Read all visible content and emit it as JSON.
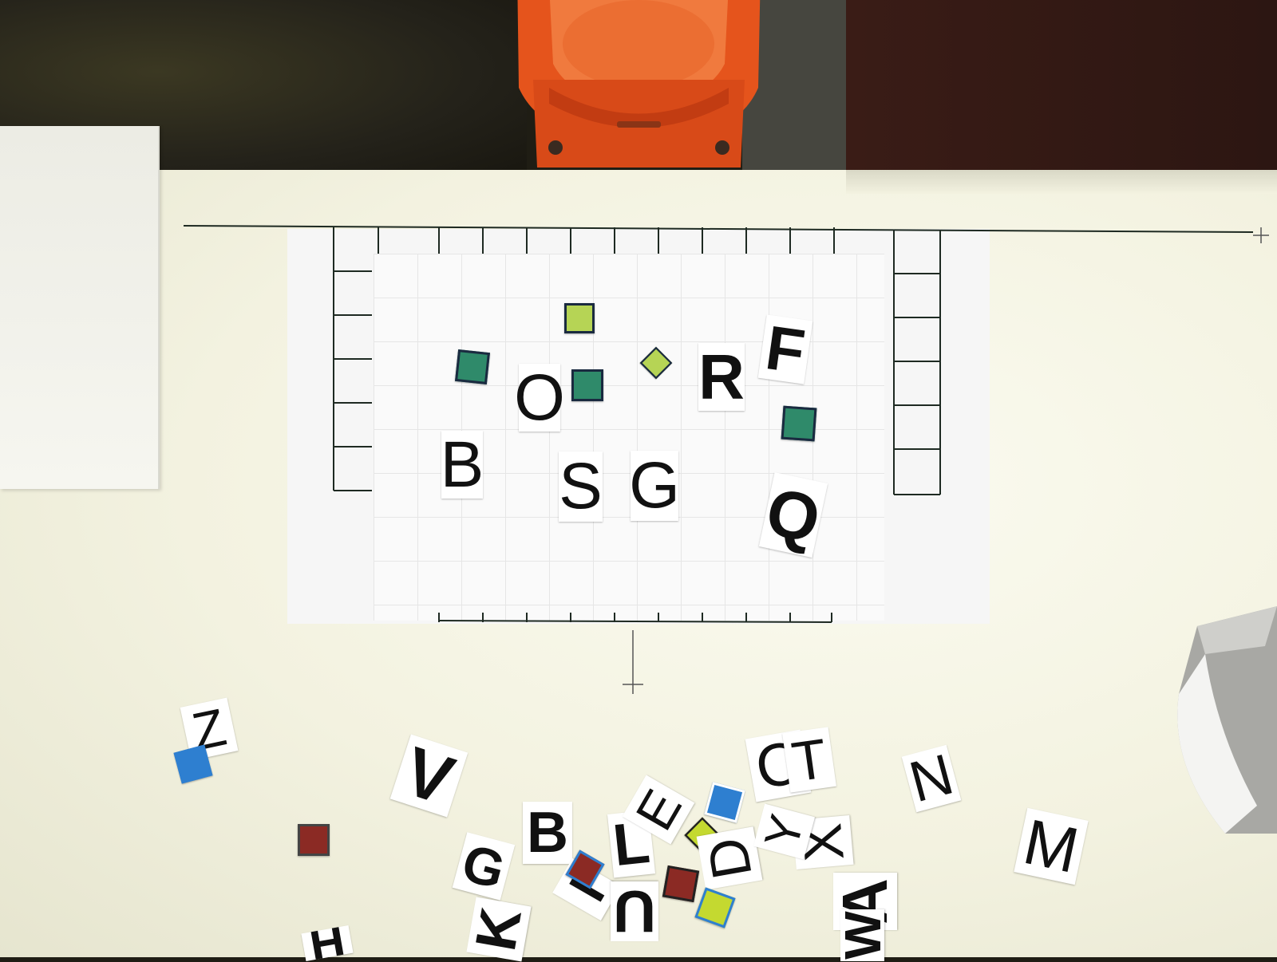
{
  "scene": {
    "board_letters": [
      "B",
      "O",
      "S",
      "G",
      "R",
      "F",
      "Q"
    ],
    "pile_letters": [
      "Z",
      "V",
      "B",
      "G",
      "L",
      "E",
      "C",
      "A",
      "N",
      "K",
      "I",
      "U",
      "D",
      "T",
      "X",
      "Y",
      "H",
      "W",
      "M"
    ]
  },
  "colors": {
    "table": "#f3f2e0",
    "robot": "#e5541c",
    "floor": "#24221a",
    "square_green": "#2f8a6a",
    "square_lime": "#b6d455",
    "square_blue": "#2e7fd0",
    "square_red": "#8b2a24",
    "square_star": "#c4d930",
    "ink": "#111111"
  },
  "icons": [
    "robot-arm",
    "letter-tile",
    "marker-square",
    "paper-stack",
    "folded-box"
  ]
}
